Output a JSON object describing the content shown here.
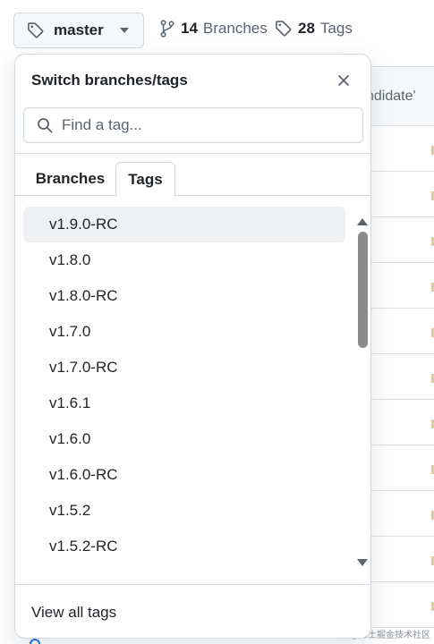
{
  "top_bar": {
    "branch_button": {
      "label": "master",
      "icon": "tag-icon"
    },
    "branches_link": {
      "count": "14",
      "label": "Branches",
      "icon": "git-branch-icon"
    },
    "tags_link": {
      "count": "28",
      "label": "Tags",
      "icon": "tag-icon"
    }
  },
  "background": {
    "header_text": "ndidate'"
  },
  "dropdown": {
    "title": "Switch branches/tags",
    "search": {
      "placeholder": "Find a tag...",
      "value": ""
    },
    "tabs": [
      {
        "label": "Branches",
        "selected": false
      },
      {
        "label": "Tags",
        "selected": true
      }
    ],
    "tags": [
      "v1.9.0-RC",
      "v1.8.0",
      "v1.8.0-RC",
      "v1.7.0",
      "v1.7.0-RC",
      "v1.6.1",
      "v1.6.0",
      "v1.6.0-RC",
      "v1.5.2",
      "v1.5.2-RC"
    ],
    "footer_link": "View all tags"
  },
  "watermark": "@稀土掘金技术社区",
  "colors": {
    "accent": "#0969da",
    "border": "#d0d7de",
    "hover": "#eff1f3"
  }
}
